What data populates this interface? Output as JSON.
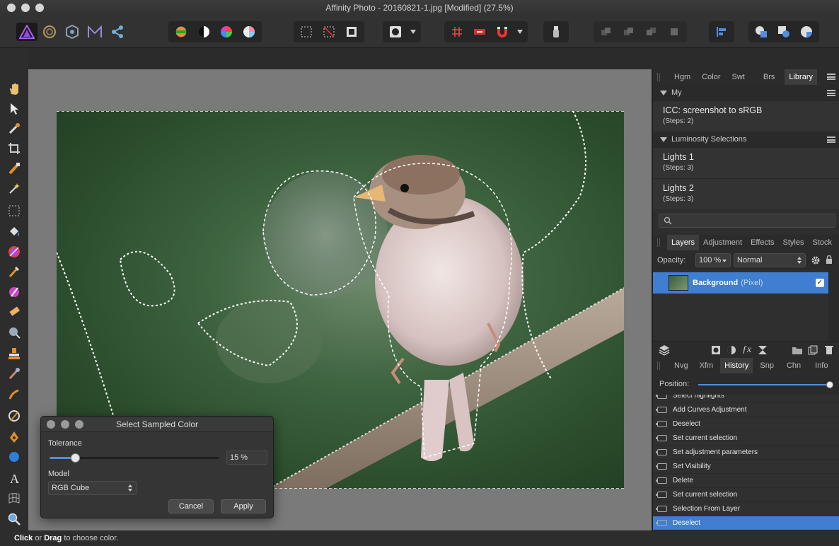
{
  "window": {
    "title": "Affinity Photo - 20160821-1.jpg [Modified] (27.5%)"
  },
  "toolbar": {
    "personas": [
      "photo-persona-icon",
      "liquify-persona-icon",
      "develop-persona-icon",
      "tone-mapping-persona-icon",
      "export-persona-icon"
    ],
    "quick_adjust": [
      "hsl-icon",
      "levels-icon",
      "color-wheel-icon",
      "white-balance-icon"
    ],
    "accent_color": "#4f8ee0"
  },
  "panel": {
    "top_tabs": [
      "Hgm",
      "Color",
      "Swt",
      "Brs",
      "Library"
    ],
    "top_active_tab": "Library",
    "library": {
      "group_my": "My",
      "my_items": [
        {
          "name": "ICC: screenshot to sRGB",
          "steps": "(Steps: 2)"
        }
      ],
      "group_lum": "Luminosity Selections",
      "lum_items": [
        {
          "name": "Lights 1",
          "steps": "(Steps: 3)"
        },
        {
          "name": "Lights 2",
          "steps": "(Steps: 3)"
        }
      ]
    },
    "layers_tabs": [
      "Layers",
      "Adjustment",
      "Effects",
      "Styles",
      "Stock"
    ],
    "layers_active_tab": "Layers",
    "opacity_label": "Opacity:",
    "opacity_value": "100 %",
    "blend_mode": "Normal",
    "layer": {
      "name": "Background",
      "type": "(Pixel)",
      "visible": true
    },
    "history_tabs": [
      "Nvg",
      "Xfm",
      "History",
      "Snp",
      "Chn",
      "Info"
    ],
    "history_active_tab": "History",
    "position_label": "Position:",
    "position_fraction": 1.0,
    "history": [
      "Select highlights",
      "Add Curves Adjustment",
      "Deselect",
      "Set current selection",
      "Set adjustment parameters",
      "Set Visibility",
      "Delete",
      "Set current selection",
      "Selection From Layer",
      "Deselect"
    ],
    "history_selected_index": 9
  },
  "dialog": {
    "title": "Select Sampled Color",
    "tolerance_label": "Tolerance",
    "tolerance_value": "15 %",
    "tolerance_fraction": 0.15,
    "model_label": "Model",
    "model_value": "RGB Cube",
    "cancel_label": "Cancel",
    "apply_label": "Apply"
  },
  "status": {
    "click": "Click",
    "or": " or ",
    "drag": "Drag",
    "rest": " to choose color."
  }
}
